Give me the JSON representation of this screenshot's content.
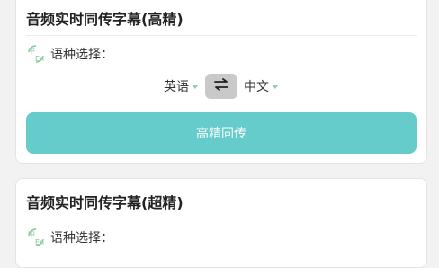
{
  "cards": [
    {
      "title": "音频实时同传字幕(高精)",
      "language_label": "语种选择：",
      "source_language": "英语",
      "target_language": "中文",
      "action_label": "高精同传"
    },
    {
      "title": "音频实时同传字幕(超精)",
      "language_label": "语种选择："
    }
  ],
  "icons": {
    "language": "language-zh-en-icon",
    "swap": "swap-arrows-icon",
    "caret": "caret-down-icon"
  },
  "colors": {
    "accent": "#66cccb",
    "icon_green": "#7fc794",
    "swap_bg": "#c9c9c9",
    "caret": "#8fd0a8"
  }
}
